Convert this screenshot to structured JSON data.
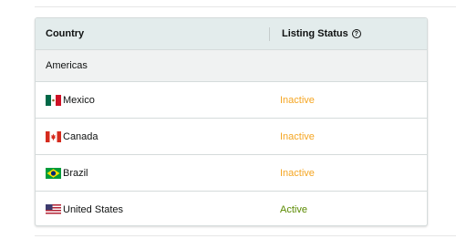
{
  "table": {
    "headers": {
      "country": "Country",
      "listing_status": "Listing Status"
    },
    "help_icon": "?",
    "group": {
      "label": "Americas"
    },
    "rows": [
      {
        "flag": "mexico-flag-icon",
        "country": "Mexico",
        "status": "Inactive"
      },
      {
        "flag": "canada-flag-icon",
        "country": "Canada",
        "status": "Inactive"
      },
      {
        "flag": "brazil-flag-icon",
        "country": "Brazil",
        "status": "Inactive"
      },
      {
        "flag": "united-states-flag-icon",
        "country": "United States",
        "status": "Active"
      }
    ]
  },
  "colors": {
    "inactive": "#f5a623",
    "active": "#5a8a00",
    "header_bg": "#e3ecec",
    "group_bg": "#f0f2f2"
  }
}
